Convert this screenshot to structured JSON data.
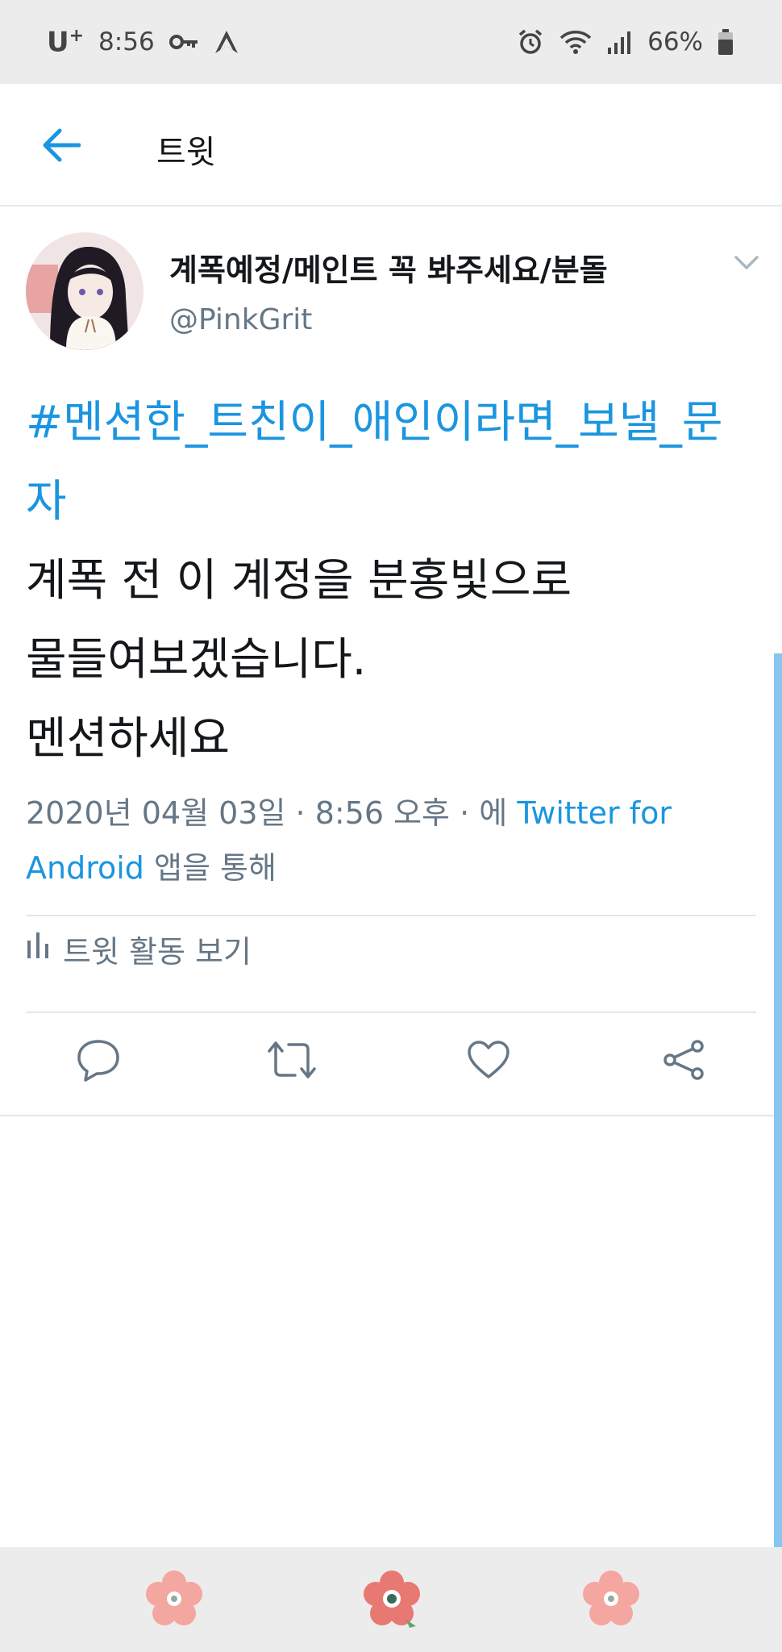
{
  "status_bar": {
    "carrier": "U",
    "carrier_sup": "+",
    "time": "8:56",
    "battery": "66%"
  },
  "header": {
    "title": "트윗",
    "back_icon": "arrow-left-icon"
  },
  "tweet": {
    "display_name": "계폭예정/메인트 꼭 봐주세요/분돌",
    "handle": "@PinkGrit",
    "hashtag": "#멘션한_트친이_애인이라면_보낼_문자",
    "lines": [
      "계폭 전 이 계정을 분홍빛으로",
      "물들여보겠습니다.",
      "멘션하세요"
    ],
    "meta_prefix": "2020년 04월 03일 · 8:56 오후 · 에 ",
    "meta_link": "Twitter for Android",
    "meta_suffix": " 앱을 통해",
    "activity_label": "트윗 활동 보기"
  },
  "actions": [
    "reply-icon",
    "retweet-icon",
    "like-icon",
    "share-icon"
  ],
  "colors": {
    "accent": "#1b95e0",
    "secondary_text": "#657786",
    "flower": "#f4a6a0",
    "flower_center_active": "#e05a52"
  }
}
